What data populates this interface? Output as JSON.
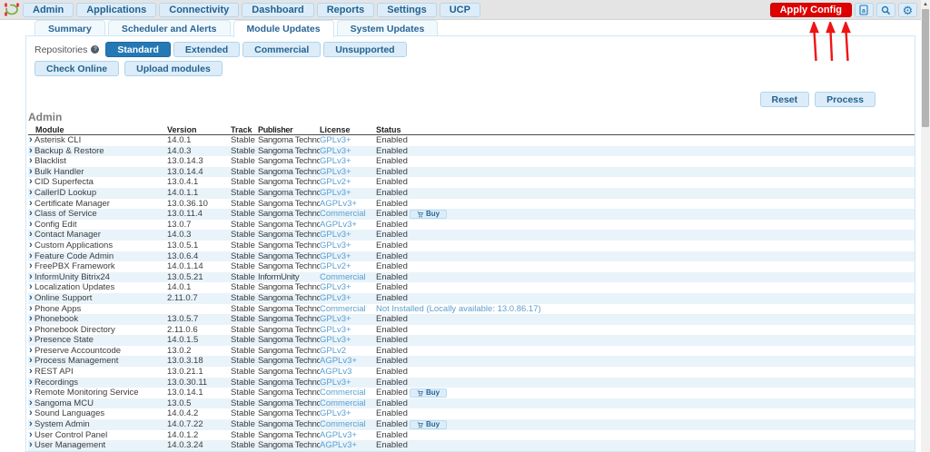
{
  "navbar": {
    "items": [
      "Admin",
      "Applications",
      "Connectivity",
      "Dashboard",
      "Reports",
      "Settings",
      "UCP"
    ],
    "apply_config_label": "Apply Config"
  },
  "tabs": [
    {
      "label": "Summary",
      "active": false
    },
    {
      "label": "Scheduler and Alerts",
      "active": false
    },
    {
      "label": "Module Updates",
      "active": true
    },
    {
      "label": "System Updates",
      "active": false
    }
  ],
  "repositories": {
    "label": "Repositories",
    "buttons": [
      {
        "label": "Standard",
        "active": true
      },
      {
        "label": "Extended",
        "active": false
      },
      {
        "label": "Commercial",
        "active": false
      },
      {
        "label": "Unsupported",
        "active": false
      }
    ]
  },
  "actions": {
    "check_online": "Check Online",
    "upload_modules": "Upload modules",
    "reset": "Reset",
    "process": "Process"
  },
  "section_title": "Admin",
  "table": {
    "headers": [
      "Module",
      "Version",
      "Track",
      "Publisher",
      "License",
      "Status"
    ],
    "buy_label": "Buy",
    "rows": [
      {
        "module": "Asterisk CLI",
        "version": "14.0.1",
        "track": "Stable",
        "publisher": "Sangoma Technologie",
        "license": "GPLv3+",
        "status": "Enabled",
        "buy": false
      },
      {
        "module": "Backup & Restore",
        "version": "14.0.3",
        "track": "Stable",
        "publisher": "Sangoma Technologie",
        "license": "GPLv3+",
        "status": "Enabled",
        "buy": false
      },
      {
        "module": "Blacklist",
        "version": "13.0.14.3",
        "track": "Stable",
        "publisher": "Sangoma Technologie",
        "license": "GPLv3+",
        "status": "Enabled",
        "buy": false
      },
      {
        "module": "Bulk Handler",
        "version": "13.0.14.4",
        "track": "Stable",
        "publisher": "Sangoma Technologie",
        "license": "GPLv3+",
        "status": "Enabled",
        "buy": false
      },
      {
        "module": "CID Superfecta",
        "version": "13.0.4.1",
        "track": "Stable",
        "publisher": "Sangoma Technologie",
        "license": "GPLv2+",
        "status": "Enabled",
        "buy": false
      },
      {
        "module": "CallerID Lookup",
        "version": "14.0.1.1",
        "track": "Stable",
        "publisher": "Sangoma Technologie",
        "license": "GPLv3+",
        "status": "Enabled",
        "buy": false
      },
      {
        "module": "Certificate Manager",
        "version": "13.0.36.10",
        "track": "Stable",
        "publisher": "Sangoma Technologie",
        "license": "AGPLv3+",
        "status": "Enabled",
        "buy": false
      },
      {
        "module": "Class of Service",
        "version": "13.0.11.4",
        "track": "Stable",
        "publisher": "Sangoma Technologie",
        "license": "Commercial",
        "status": "Enabled",
        "buy": true
      },
      {
        "module": "Config Edit",
        "version": "13.0.7",
        "track": "Stable",
        "publisher": "Sangoma Technologie",
        "license": "AGPLv3+",
        "status": "Enabled",
        "buy": false
      },
      {
        "module": "Contact Manager",
        "version": "14.0.3",
        "track": "Stable",
        "publisher": "Sangoma Technologie",
        "license": "GPLv3+",
        "status": "Enabled",
        "buy": false
      },
      {
        "module": "Custom Applications",
        "version": "13.0.5.1",
        "track": "Stable",
        "publisher": "Sangoma Technologie",
        "license": "GPLv3+",
        "status": "Enabled",
        "buy": false
      },
      {
        "module": "Feature Code Admin",
        "version": "13.0.6.4",
        "track": "Stable",
        "publisher": "Sangoma Technologie",
        "license": "GPLv3+",
        "status": "Enabled",
        "buy": false
      },
      {
        "module": "FreePBX Framework",
        "version": "14.0.1.14",
        "track": "Stable",
        "publisher": "Sangoma Technologie",
        "license": "GPLv2+",
        "status": "Enabled",
        "buy": false
      },
      {
        "module": "InformUnity Bitrix24",
        "version": "13.0.5.21",
        "track": "Stable",
        "publisher": "InformUnity",
        "license": "Commercial",
        "status": "Enabled",
        "buy": false
      },
      {
        "module": "Localization Updates",
        "version": "14.0.1",
        "track": "Stable",
        "publisher": "Sangoma Technologie",
        "license": "GPLv3+",
        "status": "Enabled",
        "buy": false
      },
      {
        "module": "Online Support",
        "version": "2.11.0.7",
        "track": "Stable",
        "publisher": "Sangoma Technologie",
        "license": "GPLv3+",
        "status": "Enabled",
        "buy": false
      },
      {
        "module": "Phone Apps",
        "version": "",
        "track": "Stable",
        "publisher": "Sangoma Technologie",
        "license": "Commercial",
        "status": "Not Installed (Locally available: 13.0.86.17)",
        "not_installed": true,
        "buy": false
      },
      {
        "module": "Phonebook",
        "version": "13.0.5.7",
        "track": "Stable",
        "publisher": "Sangoma Technologie",
        "license": "GPLv3+",
        "status": "Enabled",
        "buy": false
      },
      {
        "module": "Phonebook Directory",
        "version": "2.11.0.6",
        "track": "Stable",
        "publisher": "Sangoma Technologie",
        "license": "GPLv3+",
        "status": "Enabled",
        "buy": false
      },
      {
        "module": "Presence State",
        "version": "14.0.1.5",
        "track": "Stable",
        "publisher": "Sangoma Technologie",
        "license": "GPLv3+",
        "status": "Enabled",
        "buy": false
      },
      {
        "module": "Preserve Accountcode",
        "version": "13.0.2",
        "track": "Stable",
        "publisher": "Sangoma Technologie",
        "license": "GPLv2",
        "status": "Enabled",
        "buy": false
      },
      {
        "module": "Process Management",
        "version": "13.0.3.18",
        "track": "Stable",
        "publisher": "Sangoma Technologie",
        "license": "AGPLv3+",
        "status": "Enabled",
        "buy": false
      },
      {
        "module": "REST API",
        "version": "13.0.21.1",
        "track": "Stable",
        "publisher": "Sangoma Technologie",
        "license": "AGPLv3",
        "status": "Enabled",
        "buy": false
      },
      {
        "module": "Recordings",
        "version": "13.0.30.11",
        "track": "Stable",
        "publisher": "Sangoma Technologie",
        "license": "GPLv3+",
        "status": "Enabled",
        "buy": false
      },
      {
        "module": "Remote Monitoring Service",
        "version": "13.0.14.1",
        "track": "Stable",
        "publisher": "Sangoma Technologie",
        "license": "Commercial",
        "status": "Enabled",
        "buy": true
      },
      {
        "module": "Sangoma MCU",
        "version": "13.0.5",
        "track": "Stable",
        "publisher": "Sangoma Technologie",
        "license": "Commercial",
        "status": "Enabled",
        "buy": false
      },
      {
        "module": "Sound Languages",
        "version": "14.0.4.2",
        "track": "Stable",
        "publisher": "Sangoma Technologie",
        "license": "GPLv3+",
        "status": "Enabled",
        "buy": false
      },
      {
        "module": "System Admin",
        "version": "14.0.7.22",
        "track": "Stable",
        "publisher": "Sangoma Technologie",
        "license": "Commercial",
        "status": "Enabled",
        "buy": true
      },
      {
        "module": "User Control Panel",
        "version": "14.0.1.2",
        "track": "Stable",
        "publisher": "Sangoma Technologie",
        "license": "AGPLv3+",
        "status": "Enabled",
        "buy": false
      },
      {
        "module": "User Management",
        "version": "14.0.3.24",
        "track": "Stable",
        "publisher": "Sangoma Technologie",
        "license": "AGPLv3+",
        "status": "Enabled",
        "buy": false
      }
    ]
  },
  "colors": {
    "accent_blue": "#2479b5",
    "button_bg": "#dcedf9",
    "button_text": "#24618e",
    "apply_red": "#de0000",
    "row_alt": "#e9f3fa",
    "link_blue": "#5a9fd0",
    "annotation_red": "#ee1515"
  },
  "annotation": {
    "type": "three-up-arrows-pointing-at-apply-config"
  }
}
